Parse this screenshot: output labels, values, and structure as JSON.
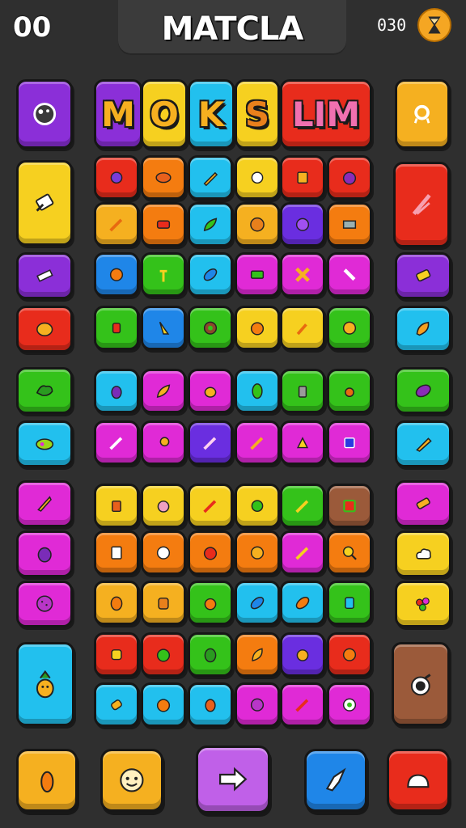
{
  "header": {
    "score_left": "00",
    "title": "MATCLA",
    "score_right": "030"
  },
  "banner": {
    "letters": [
      "M",
      "O",
      "K",
      "S",
      "LIM"
    ]
  },
  "colors": {
    "background": "#2f2f2f",
    "title_panel": "#3b3b3b",
    "letter_fill": "#f6b020"
  },
  "left_column": [
    "mushroom-icon",
    "wrench-icon",
    "pencil-icon",
    "orange-icon",
    "leaf-icon",
    "bean-icon",
    "carrot-icon",
    "eggplant-icon",
    "cookie-icon",
    "pineapple-icon"
  ],
  "right_column": [
    "ring-icon",
    "pencil-icon",
    "candy-icon",
    "leaf-icon",
    "eggplant-icon",
    "pencil-icon",
    "candy-icon",
    "cloud-icon",
    "berries-icon",
    "pot-icon"
  ],
  "bottom_bar": [
    "carrot-button",
    "face-button",
    "next-arrow-button",
    "bird-button",
    "cake-button"
  ]
}
